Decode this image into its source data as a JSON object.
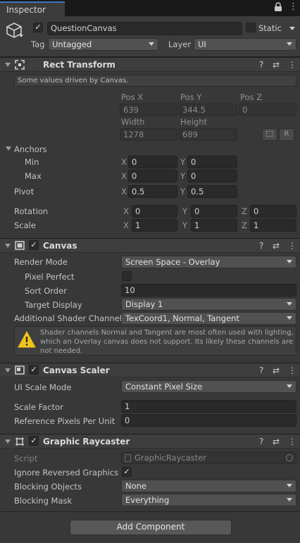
{
  "tab": {
    "title": "Inspector"
  },
  "gameobject": {
    "name": "QuestionCanvas",
    "static_label": "Static",
    "tag_label": "Tag",
    "tag_value": "Untagged",
    "layer_label": "Layer",
    "layer_value": "UI"
  },
  "rect_transform": {
    "title": "Rect Transform",
    "driven_notice": "Some values driven by Canvas.",
    "posx_label": "Pos X",
    "posy_label": "Pos Y",
    "posz_label": "Pos Z",
    "posx": "639",
    "posy": "344.5",
    "posz": "0",
    "width_label": "Width",
    "height_label": "Height",
    "width": "1278",
    "height": "689",
    "r_button": "R",
    "anchors_label": "Anchors",
    "min_label": "Min",
    "max_label": "Max",
    "axis_x": "X",
    "axis_y": "Y",
    "axis_z": "Z",
    "min_x": "0",
    "min_y": "0",
    "max_x": "0",
    "max_y": "0",
    "pivot_label": "Pivot",
    "pivot_x": "0.5",
    "pivot_y": "0.5",
    "rotation_label": "Rotation",
    "rot_x": "0",
    "rot_y": "0",
    "rot_z": "0",
    "scale_label": "Scale",
    "scale_x": "1",
    "scale_y": "1",
    "scale_z": "1"
  },
  "canvas": {
    "title": "Canvas",
    "render_mode_label": "Render Mode",
    "render_mode": "Screen Space - Overlay",
    "pixel_perfect_label": "Pixel Perfect",
    "sort_order_label": "Sort Order",
    "sort_order": "10",
    "target_display_label": "Target Display",
    "target_display": "Display 1",
    "shader_channels_label": "Additional Shader Channels",
    "shader_channels": "TexCoord1, Normal, Tangent",
    "warning": "Shader channels Normal and Tangent are most often used with lighting, which an Overlay canvas does not support. Its likely these channels are not needed."
  },
  "canvas_scaler": {
    "title": "Canvas Scaler",
    "ui_scale_mode_label": "UI Scale Mode",
    "ui_scale_mode": "Constant Pixel Size",
    "scale_factor_label": "Scale Factor",
    "scale_factor": "1",
    "ref_ppu_label": "Reference Pixels Per Unit",
    "ref_ppu": "0"
  },
  "graphic_raycaster": {
    "title": "Graphic Raycaster",
    "script_label": "Script",
    "script": "GraphicRaycaster",
    "ignore_reversed_label": "Ignore Reversed Graphics",
    "blocking_objects_label": "Blocking Objects",
    "blocking_objects": "None",
    "blocking_mask_label": "Blocking Mask",
    "blocking_mask": "Everything"
  },
  "add_component": "Add Component",
  "icons": {
    "cube": "gameobject-cube-icon",
    "lock": "lock-icon",
    "kebab": "more-options-icon",
    "help": "help-icon",
    "preset": "preset-sliders-icon",
    "warning": "warning-icon"
  }
}
